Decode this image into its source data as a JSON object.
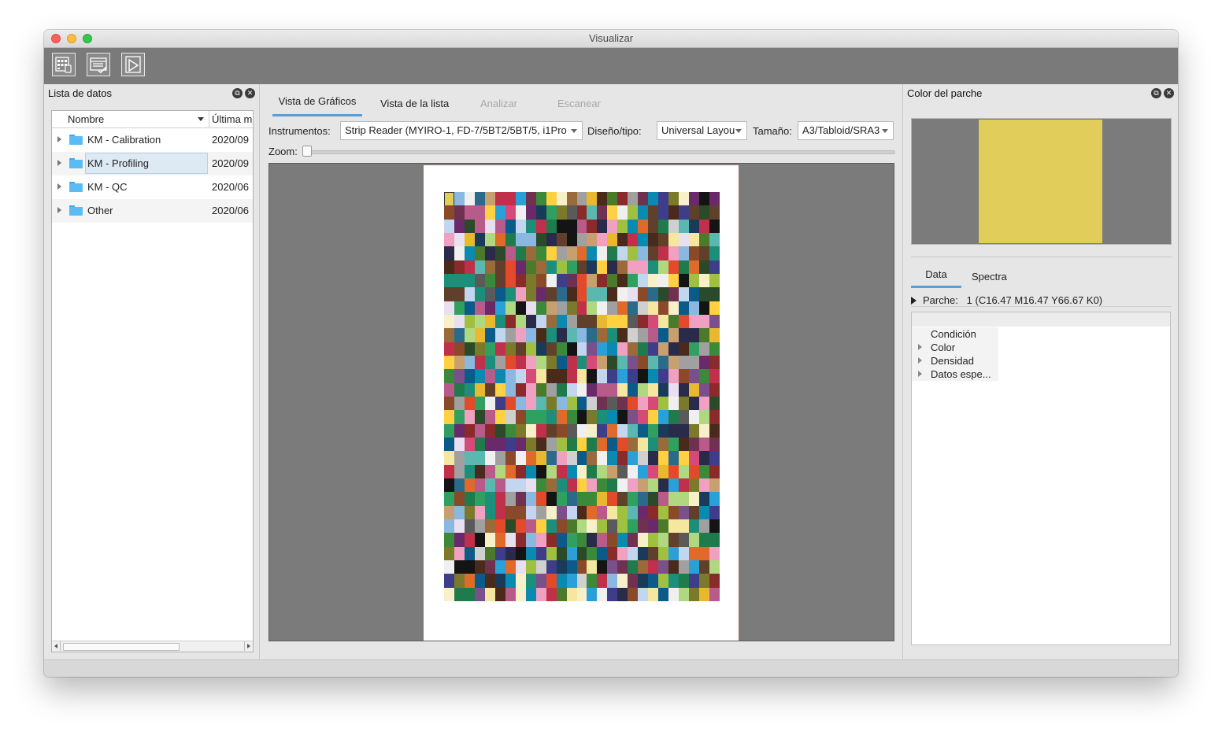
{
  "window": {
    "title": "Visualizar"
  },
  "toolbar": {
    "buttons": [
      {
        "icon": "chart-device-icon"
      },
      {
        "icon": "list-check-icon"
      },
      {
        "icon": "play-document-icon"
      }
    ]
  },
  "left_panel": {
    "title": "Lista de datos",
    "columns": {
      "name": "Nombre",
      "date": "Última m"
    },
    "rows": [
      {
        "name": "KM - Calibration",
        "date": "2020/09"
      },
      {
        "name": "KM - Profiling",
        "date": "2020/09",
        "selected": true
      },
      {
        "name": "KM - QC",
        "date": "2020/06"
      },
      {
        "name": "Other",
        "date": "2020/06"
      }
    ]
  },
  "center_panel": {
    "tabs": [
      {
        "label": "Vista de Gráficos",
        "state": "active"
      },
      {
        "label": "Vista de la lista",
        "state": "normal"
      },
      {
        "label": "Analizar",
        "state": "disabled"
      },
      {
        "label": "Escanear",
        "state": "disabled"
      }
    ],
    "instrument_label": "Instrumentos:",
    "instrument_value": "Strip Reader (MYIRO-1, FD-7/5BT2/5BT/5, i1Pro",
    "layout_label": "Diseño/tipo:",
    "layout_value": "Universal Layou",
    "size_label": "Tamaño:",
    "size_value": "A3/Tabloid/SRA3",
    "zoom_label": "Zoom:",
    "zoom_level": 0,
    "patch_grid": {
      "columns": 27,
      "rows": 30,
      "selected_index": 0
    }
  },
  "right_panel": {
    "title": "Color del parche",
    "swatch_color": "#e0cd5a",
    "tabs": [
      {
        "label": "Data",
        "state": "active"
      },
      {
        "label": "Spectra",
        "state": "normal"
      }
    ],
    "patch_label": "Parche:",
    "patch_value": "1 (C16.47 M16.47 Y66.67 K0)",
    "properties": [
      {
        "label": "Condición",
        "expandable": false
      },
      {
        "label": "Color",
        "expandable": true
      },
      {
        "label": "Densidad",
        "expandable": true
      },
      {
        "label": "Datos espe...",
        "expandable": true
      }
    ]
  },
  "colors": {
    "accent": "#5aa0d6",
    "folder": "#5bbcf2",
    "toolbar_bg": "#7a7a7a",
    "canvas_bg": "#7b7b7b"
  }
}
